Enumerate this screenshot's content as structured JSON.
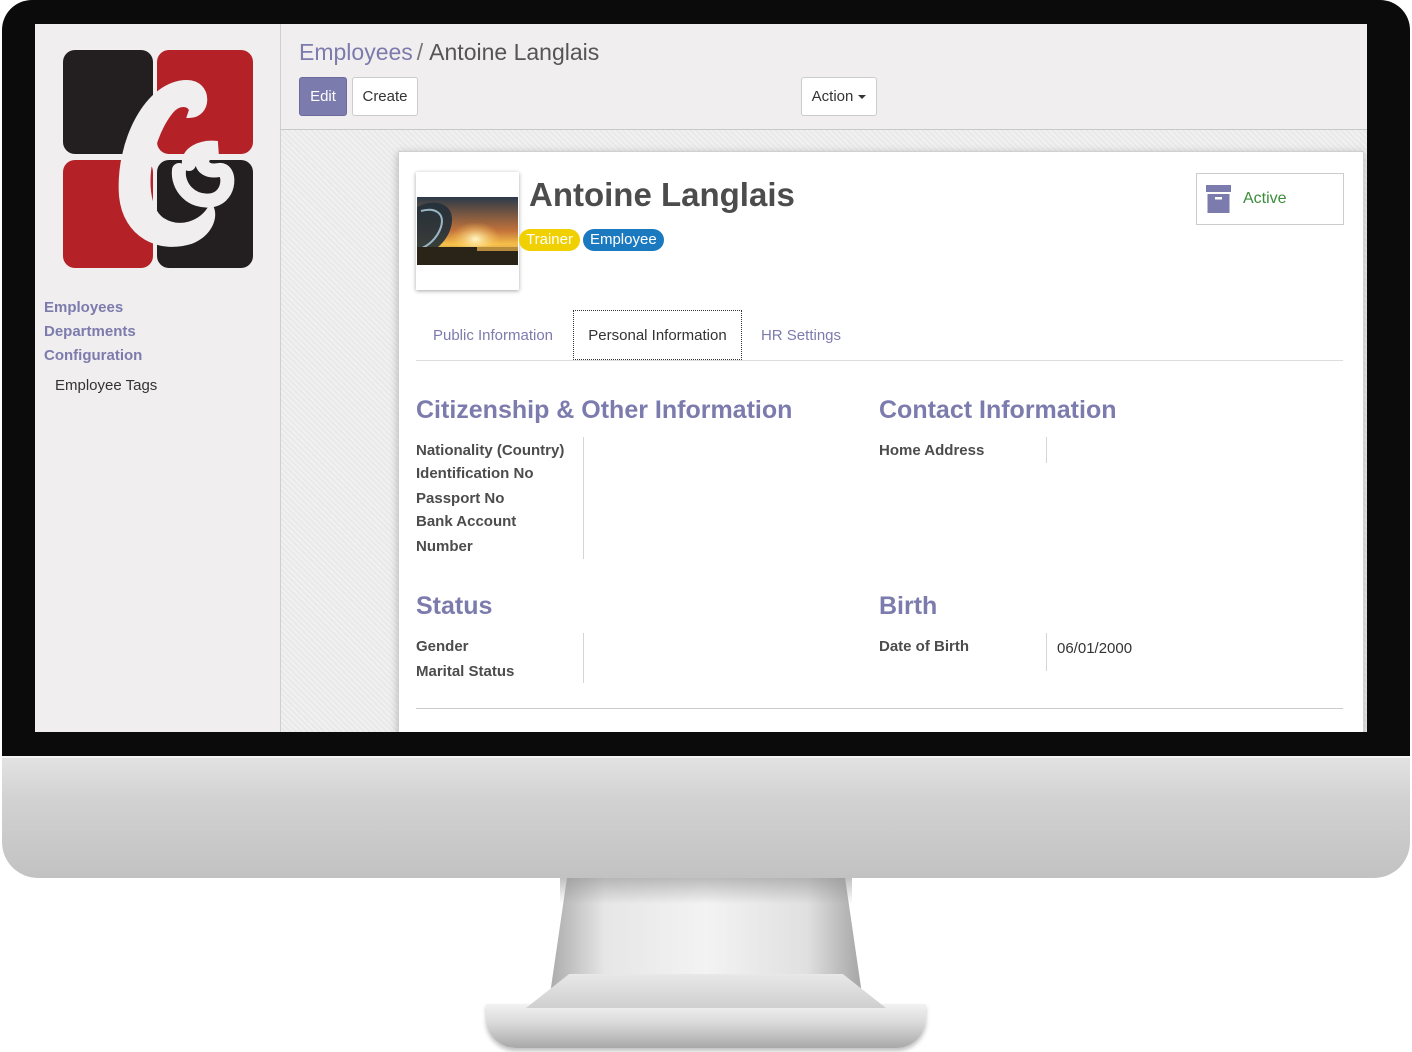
{
  "breadcrumb": {
    "parent": "Employees",
    "separator": "/",
    "current": "Antoine Langlais"
  },
  "toolbar": {
    "edit_label": "Edit",
    "create_label": "Create",
    "action_label": "Action"
  },
  "sidebar": {
    "items": [
      {
        "label": "Employees"
      },
      {
        "label": "Departments"
      },
      {
        "label": "Configuration"
      }
    ],
    "subitems": [
      {
        "label": "Employee Tags"
      }
    ]
  },
  "employee": {
    "name": "Antoine Langlais",
    "tags": [
      {
        "label": "Trainer",
        "color": "#f0d000"
      },
      {
        "label": "Employee",
        "color": "#1b79c0"
      }
    ],
    "status_button": {
      "label": "Active",
      "icon": "archive-icon"
    }
  },
  "tabs": [
    {
      "label": "Public Information",
      "active": false
    },
    {
      "label": "Personal Information",
      "active": true
    },
    {
      "label": "HR Settings",
      "active": false
    }
  ],
  "sections": {
    "citizenship": {
      "title": "Citizenship & Other Information",
      "fields": [
        "Nationality (Country)",
        "Identification No",
        "Passport No",
        "Bank Account",
        "Number"
      ]
    },
    "contact": {
      "title": "Contact Information",
      "fields": [
        "Home Address"
      ]
    },
    "status": {
      "title": "Status",
      "fields": [
        "Gender",
        "Marital Status"
      ]
    },
    "birth": {
      "title": "Birth",
      "fields": [
        "Date of Birth"
      ],
      "date_of_birth": "06/01/2000"
    }
  },
  "colors": {
    "accent": "#7c7bad",
    "active_green": "#3c8c3c",
    "logo_red": "#b42228",
    "logo_dark": "#231f20"
  }
}
